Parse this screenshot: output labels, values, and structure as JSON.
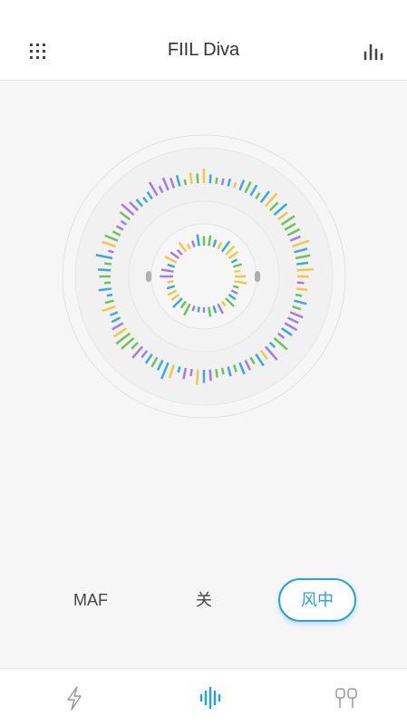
{
  "header": {
    "title": "FIIL Diva",
    "menu_icon": "grid-icon",
    "eq_icon": "equalizer-icon"
  },
  "modes": {
    "items": [
      {
        "label": "MAF",
        "active": false
      },
      {
        "label": "关",
        "active": false
      },
      {
        "label": "风中",
        "active": true
      }
    ],
    "accent_color": "#2b9fd8"
  },
  "visualizer": {
    "bar_colors": [
      "#a57be8",
      "#3aa9e0",
      "#f0c84a",
      "#6dc25b"
    ]
  },
  "tabbar": {
    "tabs": [
      {
        "icon": "lightning-icon",
        "active": false
      },
      {
        "icon": "soundwave-icon",
        "active": true
      },
      {
        "icon": "earbuds-icon",
        "active": false
      }
    ]
  }
}
